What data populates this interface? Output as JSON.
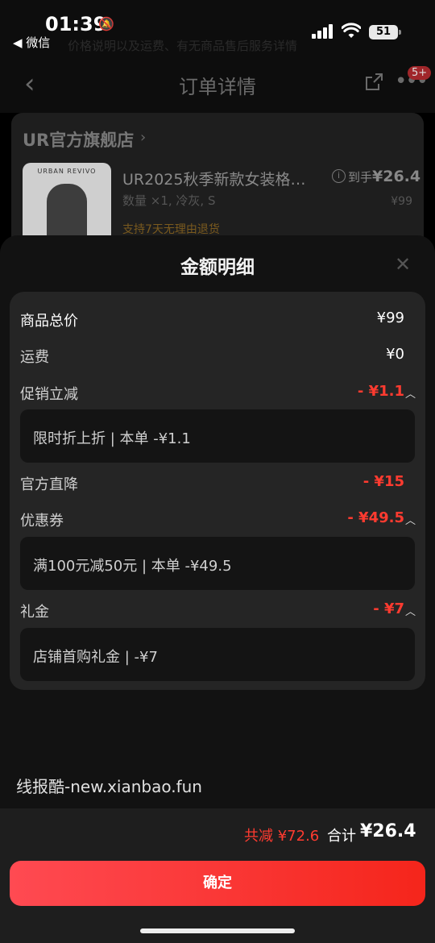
{
  "status": {
    "time": "01:39",
    "back_app": "◀ 微信",
    "battery": "51",
    "ghost_text": "价格说明以及运费、有无商品售后服务详情"
  },
  "nav": {
    "title": "订单详情",
    "badge": "5+"
  },
  "order": {
    "store": "UR官方旗舰店",
    "product_brand": "URBAN REVIVO",
    "product_title": "UR2025秋季新款女装格…",
    "spec": "数量 ×1, 冷灰, S",
    "return_policy": "支持7天无理由退货",
    "arrival_label": "到手",
    "arrival_price": "¥26.4",
    "original_price": "¥99"
  },
  "sheet": {
    "title": "金额明细",
    "rows": {
      "total_label": "商品总价",
      "total_value": "¥99",
      "shipping_label": "运费",
      "shipping_value": "¥0",
      "promo_label": "促销立减",
      "promo_value": "- ¥1.1",
      "promo_detail": "限时折上折 | 本单 -¥1.1",
      "official_label": "官方直降",
      "official_value": "- ¥15",
      "coupon_label": "优惠券",
      "coupon_value": "- ¥49.5",
      "coupon_detail": "满100元减50元 | 本单 -¥49.5",
      "gift_label": "礼金",
      "gift_value": "- ¥7",
      "gift_detail": "店铺首购礼金 | -¥7"
    }
  },
  "watermark": "线报酷-new.xianbao.fun",
  "footer": {
    "discount_total": "共减 ¥72.6",
    "sum_label": "合计",
    "sum_value": "¥26.4",
    "confirm_label": "确定"
  },
  "colors": {
    "accent_red": "#ff3b30",
    "button_gradient_start": "#ff4a52",
    "button_gradient_end": "#f5251b"
  }
}
